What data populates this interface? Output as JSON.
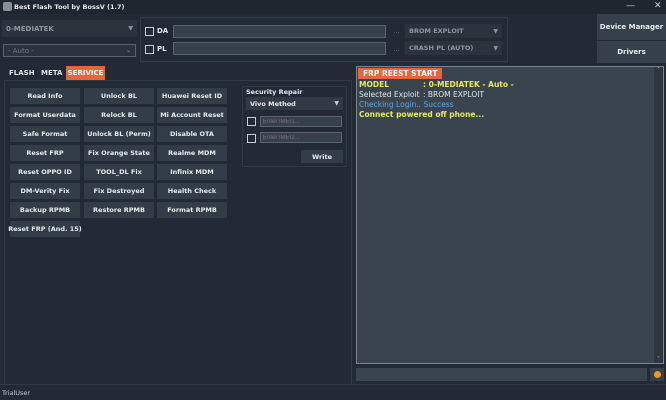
{
  "window": {
    "title": "Best Flash Tool by BossV (1.7)",
    "minimize": "—",
    "close": "✕"
  },
  "top": {
    "platform_combo": "0-MEDIATEK",
    "mode_combo": "- Auto -",
    "da_label": "DA",
    "pl_label": "PL",
    "browse": "...",
    "da_select": "BROM EXPLOIT",
    "pl_select": "CRASH PL (AUTO)",
    "device_manager": "Device Manager",
    "drivers": "Drivers"
  },
  "tabs": [
    {
      "label": "FLASH"
    },
    {
      "label": "META"
    },
    {
      "label": "SERIVICE",
      "active": true
    }
  ],
  "buttons": [
    [
      "Read Info",
      "Unlock BL",
      "Huawei Reset ID"
    ],
    [
      "Format Userdata",
      "Relock BL",
      "Mi Account Reset"
    ],
    [
      "Safe Format",
      "Unlock BL (Perm)",
      "Disable OTA"
    ],
    [
      "Reset FRP",
      "Fix Orange State",
      "Realme MDM"
    ],
    [
      "Reset OPPO ID",
      "TOOL_DL Fix",
      "Infinix MDM"
    ],
    [
      "DM-Verity Fix",
      "Fix Destroyed",
      "Health Check"
    ],
    [
      "Backup RPMB",
      "Restore RPMB",
      "Format RPMB"
    ],
    [
      "Reset FRP (And. 15)"
    ]
  ],
  "security": {
    "title": "Security Repair",
    "method": "Vivo Method",
    "imei1_placeholder": "Enter IMEI1...",
    "imei2_placeholder": "Enter IMEI2...",
    "write": "Write"
  },
  "log": {
    "header": "FRP REEST START",
    "lines": [
      {
        "k": "MODEL",
        "v": ": 0-MEDIATEK - Auto -",
        "color": "#e8e85a"
      },
      {
        "k": "Selected Exploit",
        "v": ": BROM EXPLOIT",
        "color": "#dfe3e7"
      },
      {
        "k": "Checking Login.. Success",
        "v": "",
        "color": "#5aa8e8"
      },
      {
        "k": "Connect powered off phone...",
        "v": "",
        "color": "#e8e85a"
      }
    ],
    "accent": "#e8643a"
  },
  "status": {
    "user": "TrialUser"
  }
}
